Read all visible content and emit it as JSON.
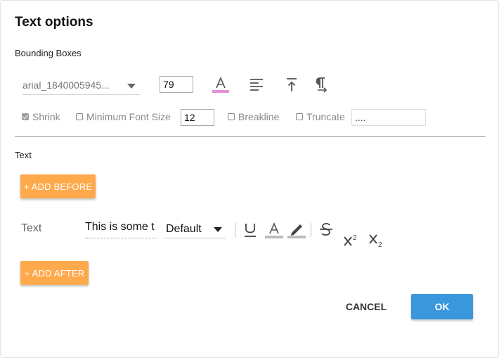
{
  "dialog": {
    "title": "Text options",
    "bounding_boxes_label": "Bounding Boxes",
    "font_select_value": "arial_1840005945...",
    "font_size_value": "79",
    "font_color_accent": "#e48fd6",
    "shrink_label": "Shrink",
    "shrink_checked": true,
    "min_font_label": "Minimum Font Size",
    "min_font_value": "12",
    "breakline_label": "Breakline",
    "truncate_label": "Truncate",
    "truncate_value": "....",
    "text_section_label": "Text",
    "add_before_label": "+ ADD BEFORE",
    "add_after_label": "+ ADD AFTER",
    "row_label": "Text",
    "row_value": "This is some t",
    "row_font_value": "Default",
    "cancel_label": "CANCEL",
    "ok_label": "OK",
    "ok_color": "#3a97db",
    "orange_color": "#ffa94d"
  }
}
